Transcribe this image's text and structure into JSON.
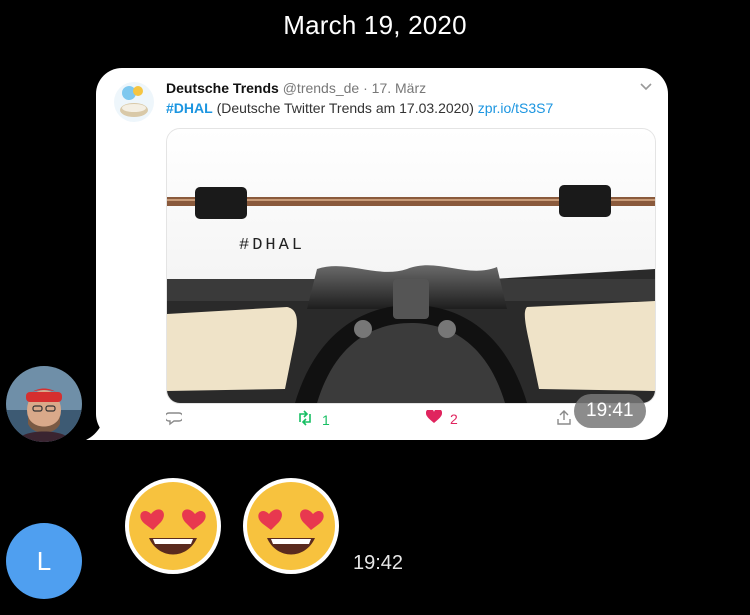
{
  "date_header": "March 19, 2020",
  "sender": {
    "avatar_desc": "avatar"
  },
  "tweet": {
    "author_name": "Deutsche Trends",
    "author_handle": "@trends_de",
    "separator": "·",
    "date": "17. März",
    "hashtag": "#DHAL",
    "text": "(Deutsche Twitter Trends am 17.03.2020)",
    "link": "zpr.io/tS3S7",
    "media_caption": "#DHAL",
    "retweets": "1",
    "likes": "2",
    "time": "19:41"
  },
  "reply": {
    "avatar_letter": "L",
    "emojis": [
      "😍",
      "😍"
    ],
    "time": "19:42"
  },
  "colors": {
    "background": "#000000",
    "bubble": "#ffffff",
    "link": "#1b95e0",
    "retweet": "#17bf63",
    "like": "#e0245e",
    "user_avatar": "#4f9ff0"
  }
}
